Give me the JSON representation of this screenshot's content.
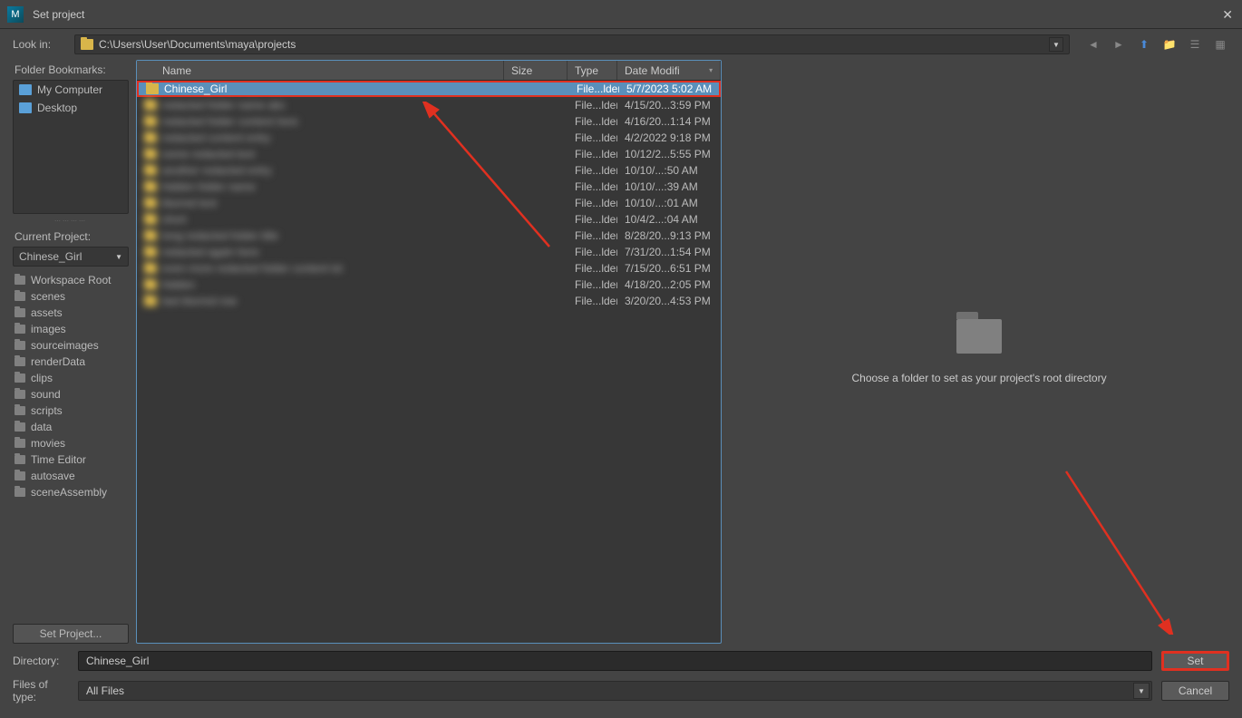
{
  "window": {
    "title": "Set project",
    "appIcon": "M"
  },
  "toolbar": {
    "lookInLabel": "Look in:",
    "path": "C:\\Users\\User\\Documents\\maya\\projects"
  },
  "bookmarks": {
    "label": "Folder Bookmarks:",
    "items": [
      {
        "label": "My Computer"
      },
      {
        "label": "Desktop"
      }
    ]
  },
  "currentProject": {
    "label": "Current Project:",
    "selected": "Chinese_Girl",
    "tree": [
      "Workspace Root",
      "scenes",
      "assets",
      "images",
      "sourceimages",
      "renderData",
      "clips",
      "sound",
      "scripts",
      "data",
      "movies",
      "Time Editor",
      "autosave",
      "sceneAssembly"
    ],
    "setBtn": "Set Project..."
  },
  "fileList": {
    "columns": {
      "name": "Name",
      "size": "Size",
      "type": "Type",
      "date": "Date Modifi"
    },
    "rows": [
      {
        "name": "Chinese_Girl",
        "type": "File...lder",
        "date": "5/7/2023 5:02 AM",
        "selected": true,
        "blur": false
      },
      {
        "name": "redacted folder name abc",
        "type": "File...lder",
        "date": "4/15/20...3:59 PM",
        "blur": true
      },
      {
        "name": "redacted folder content here",
        "type": "File...lder",
        "date": "4/16/20...1:14 PM",
        "blur": true
      },
      {
        "name": "redacted content entry",
        "type": "File...lder",
        "date": "4/2/2022 9:18 PM",
        "blur": true
      },
      {
        "name": "some redacted text",
        "type": "File...lder",
        "date": "10/12/2...5:55 PM",
        "blur": true
      },
      {
        "name": "another redacted entry",
        "type": "File...lder",
        "date": "10/10/...:50 AM",
        "blur": true
      },
      {
        "name": "hidden folder name",
        "type": "File...lder",
        "date": "10/10/...:39 AM",
        "blur": true
      },
      {
        "name": "blurred text",
        "type": "File...lder",
        "date": "10/10/...:01 AM",
        "blur": true
      },
      {
        "name": "short",
        "type": "File...lder",
        "date": "10/4/2...:04 AM",
        "blur": true
      },
      {
        "name": "long redacted folder title",
        "type": "File...lder",
        "date": "8/28/20...9:13 PM",
        "blur": true
      },
      {
        "name": "redacted again here",
        "type": "File...lder",
        "date": "7/31/20...1:54 PM",
        "blur": true
      },
      {
        "name": "even more redacted folder content txt",
        "type": "File...lder",
        "date": "7/15/20...6:51 PM",
        "blur": true
      },
      {
        "name": "hidden",
        "type": "File...lder",
        "date": "4/18/20...2:05 PM",
        "blur": true
      },
      {
        "name": "last blurred row",
        "type": "File...lder",
        "date": "3/20/20...4:53 PM",
        "blur": true
      }
    ]
  },
  "preview": {
    "message": "Choose a folder to set as your project's root directory"
  },
  "bottom": {
    "dirLabel": "Directory:",
    "dirValue": "Chinese_Girl",
    "typeLabel": "Files of type:",
    "typeValue": "All Files",
    "setBtn": "Set",
    "cancelBtn": "Cancel"
  }
}
